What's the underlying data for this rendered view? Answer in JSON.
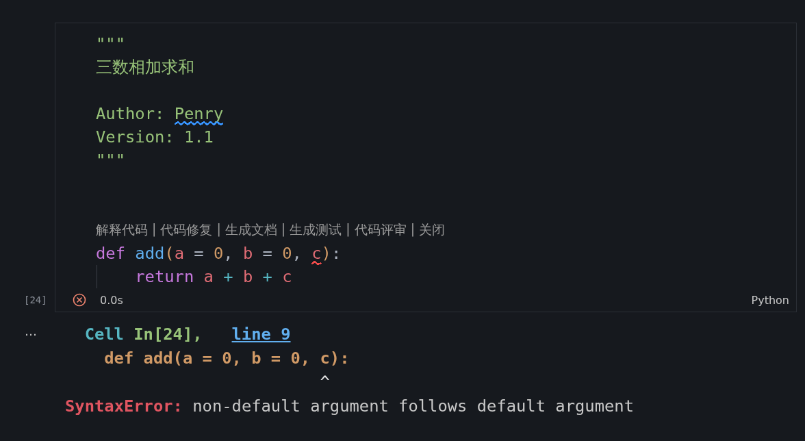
{
  "cell": {
    "execution_count": "[24]",
    "succeeded": false,
    "duration": "0.0s",
    "language": "Python",
    "lines": [
      {
        "kind": "code",
        "indent_guide": false,
        "tokens": [
          {
            "text": "\"\"\"",
            "kind": "string"
          }
        ]
      },
      {
        "kind": "code",
        "indent_guide": false,
        "tokens": [
          {
            "text": "三数相加求和",
            "kind": "string"
          }
        ]
      },
      {
        "kind": "blank"
      },
      {
        "kind": "code",
        "indent_guide": false,
        "tokens": [
          {
            "text": "Author: ",
            "kind": "string"
          },
          {
            "text": "Penry",
            "kind": "string",
            "squiggle": {
              "color": "#3794ff"
            }
          }
        ]
      },
      {
        "kind": "code",
        "indent_guide": false,
        "tokens": [
          {
            "text": "Version: 1.1",
            "kind": "string"
          }
        ]
      },
      {
        "kind": "code",
        "indent_guide": false,
        "tokens": [
          {
            "text": "\"\"\"",
            "kind": "string"
          }
        ]
      },
      {
        "kind": "blank"
      },
      {
        "kind": "blank"
      },
      {
        "kind": "actions",
        "separator": "|",
        "actions": [
          "解释代码",
          "代码修复",
          "生成文档",
          "生成测试",
          "代码评审",
          "关闭"
        ]
      },
      {
        "kind": "code",
        "indent_guide": false,
        "tokens": [
          {
            "text": "def",
            "kind": "keyword"
          },
          {
            "text": " add",
            "kind": "function"
          },
          {
            "text": "(",
            "kind": "paren"
          },
          {
            "text": "a",
            "kind": "variable"
          },
          {
            "text": " = ",
            "kind": "plain"
          },
          {
            "text": "0",
            "kind": "number"
          },
          {
            "text": ", ",
            "kind": "plain"
          },
          {
            "text": "b",
            "kind": "variable"
          },
          {
            "text": " = ",
            "kind": "plain"
          },
          {
            "text": "0",
            "kind": "number"
          },
          {
            "text": ", ",
            "kind": "plain"
          },
          {
            "text": "c",
            "kind": "variable",
            "squiggle": {
              "color": "#f14c4c"
            }
          },
          {
            "text": ")",
            "kind": "paren"
          },
          {
            "text": ":",
            "kind": "plain"
          }
        ]
      },
      {
        "kind": "code",
        "indent_guide": true,
        "tokens": [
          {
            "text": "return",
            "kind": "keyword"
          },
          {
            "text": " a",
            "kind": "variable"
          },
          {
            "text": " + ",
            "kind": "operator"
          },
          {
            "text": "b",
            "kind": "variable"
          },
          {
            "text": " + ",
            "kind": "operator"
          },
          {
            "text": "c",
            "kind": "variable"
          }
        ]
      }
    ]
  },
  "output": {
    "more": "…",
    "lines": [
      {
        "kind": "location",
        "tokens": [
          {
            "text": "Cell",
            "kind": "location"
          },
          {
            "text": "In[24],",
            "kind": "cell_ref"
          },
          {
            "text": "line 9",
            "kind": "link"
          }
        ]
      },
      {
        "kind": "source",
        "tokens": [
          {
            "text": "def add(a = 0, b = 0, c):",
            "kind": "source"
          }
        ]
      },
      {
        "kind": "caret",
        "tokens": [
          {
            "text": "^",
            "kind": "caret"
          }
        ]
      },
      {
        "kind": "error",
        "tokens": [
          {
            "text": "SyntaxError:",
            "kind": "error_type"
          },
          {
            "text": "non-default argument follows default argument",
            "kind": "message"
          }
        ]
      }
    ]
  }
}
